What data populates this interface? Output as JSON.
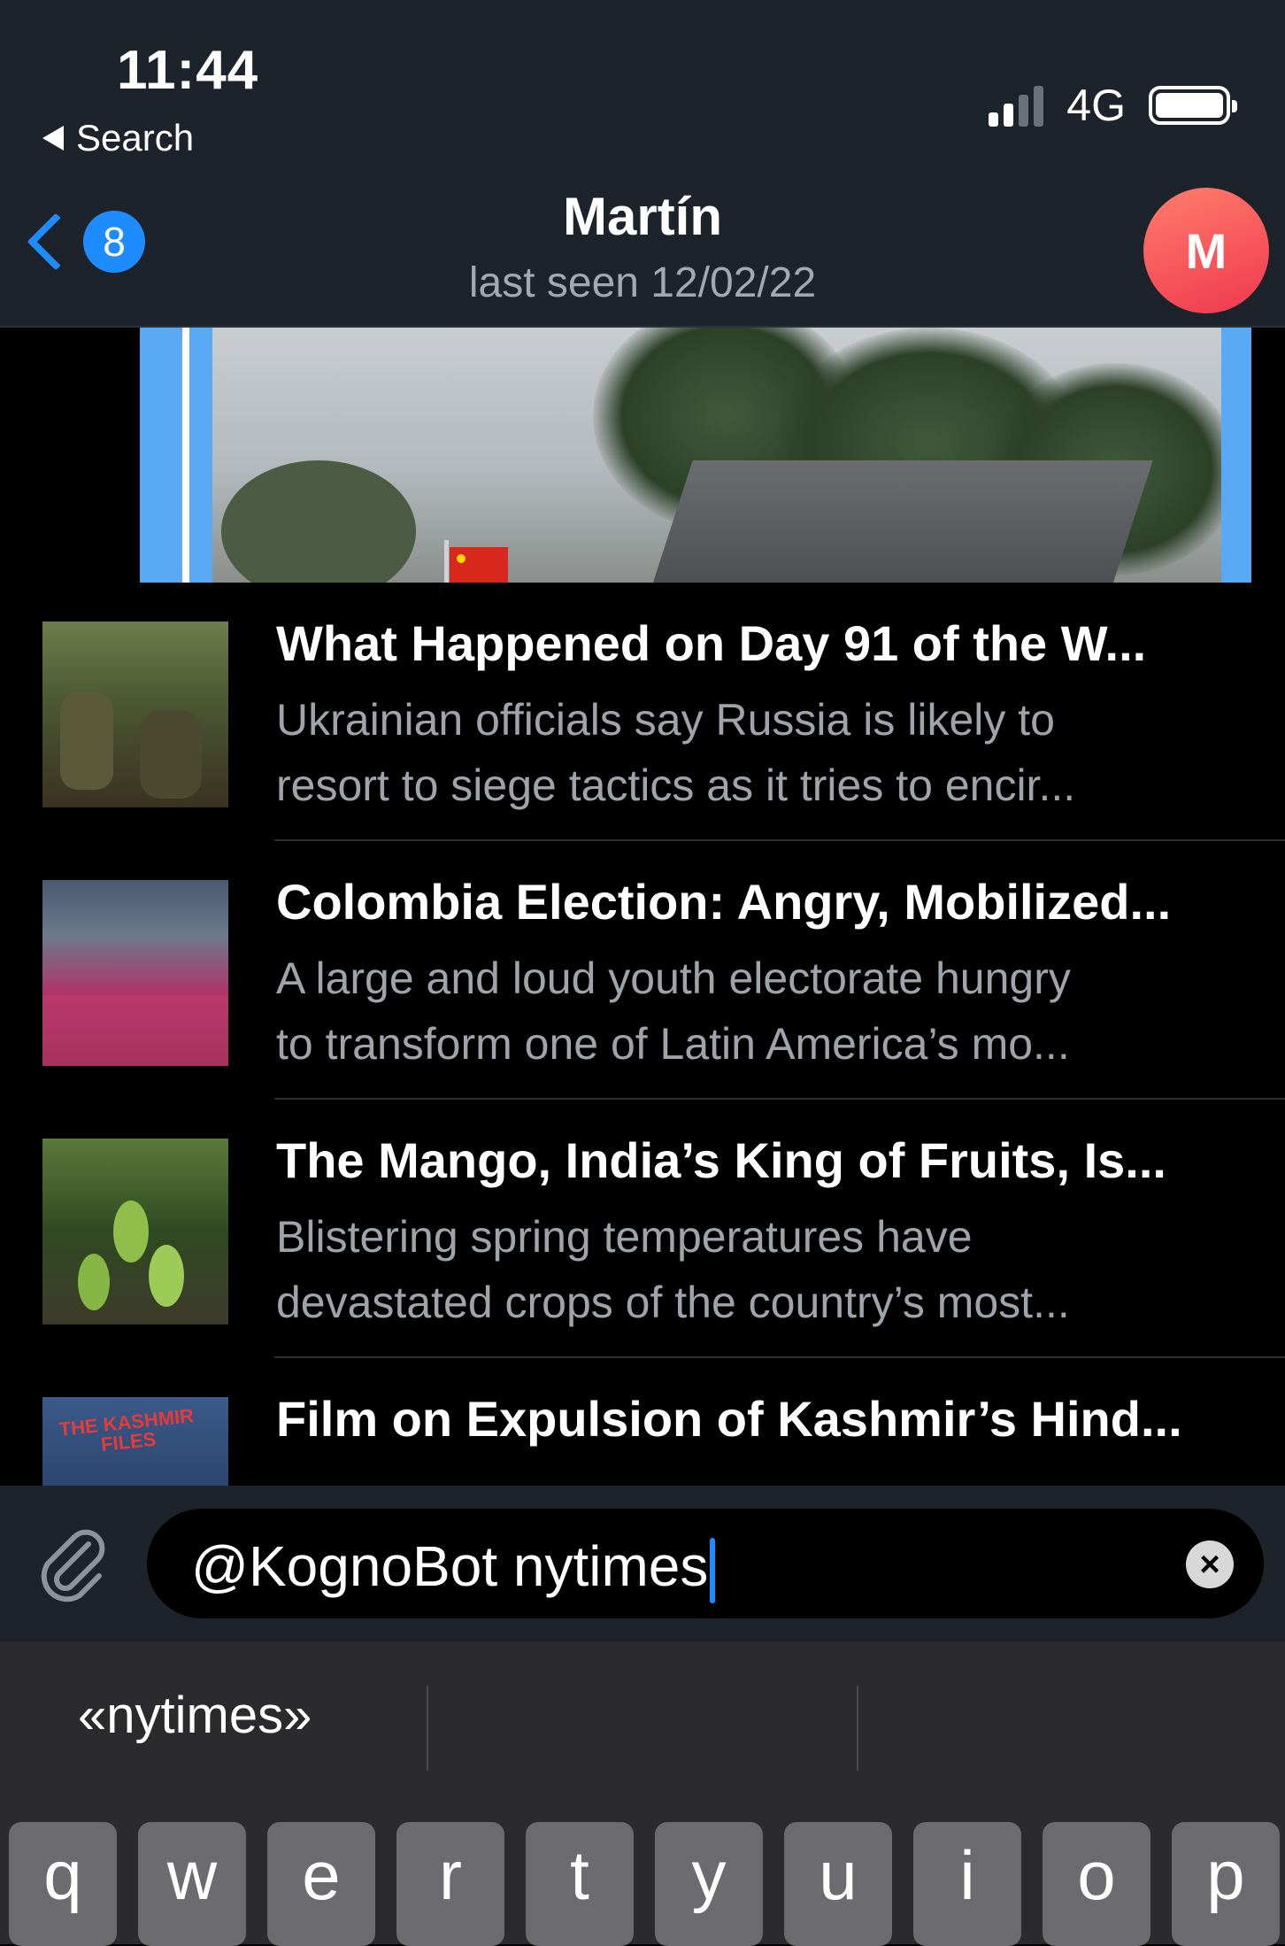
{
  "status_bar": {
    "time": "11:44",
    "back_app": "Search",
    "network": "4G"
  },
  "chat_header": {
    "unread_count": "8",
    "contact_name": "Martín",
    "last_seen": "last seen 12/02/22",
    "avatar_letter": "M"
  },
  "results": [
    {
      "title": "What Happened on Day 91 of the W...",
      "desc_line1": "Ukrainian officials say Russia is likely to",
      "desc_line2": "resort to siege tactics as it tries to encir..."
    },
    {
      "title": "Colombia Election: Angry, Mobilized...",
      "desc_line1": "A large and loud youth electorate hungry",
      "desc_line2": "to transform one of Latin America’s mo..."
    },
    {
      "title": "The Mango, India’s King of Fruits, Is...",
      "desc_line1": "Blistering spring temperatures have",
      "desc_line2": "devastated crops of the country’s most..."
    },
    {
      "title": "Film on Expulsion of Kashmir’s Hind...",
      "desc_line1": "",
      "desc_line2": "",
      "thumb_text": "THE KASHMIR FILES"
    }
  ],
  "input": {
    "value": "@KognoBot nytimes"
  },
  "keyboard": {
    "suggestion": "«nytimes»",
    "row1": [
      "q",
      "w",
      "e",
      "r",
      "t",
      "y",
      "u",
      "i",
      "o",
      "p"
    ]
  },
  "colors": {
    "accent": "#1e8cff",
    "header_bg": "#1c232b",
    "avatar": "#f0384f"
  }
}
